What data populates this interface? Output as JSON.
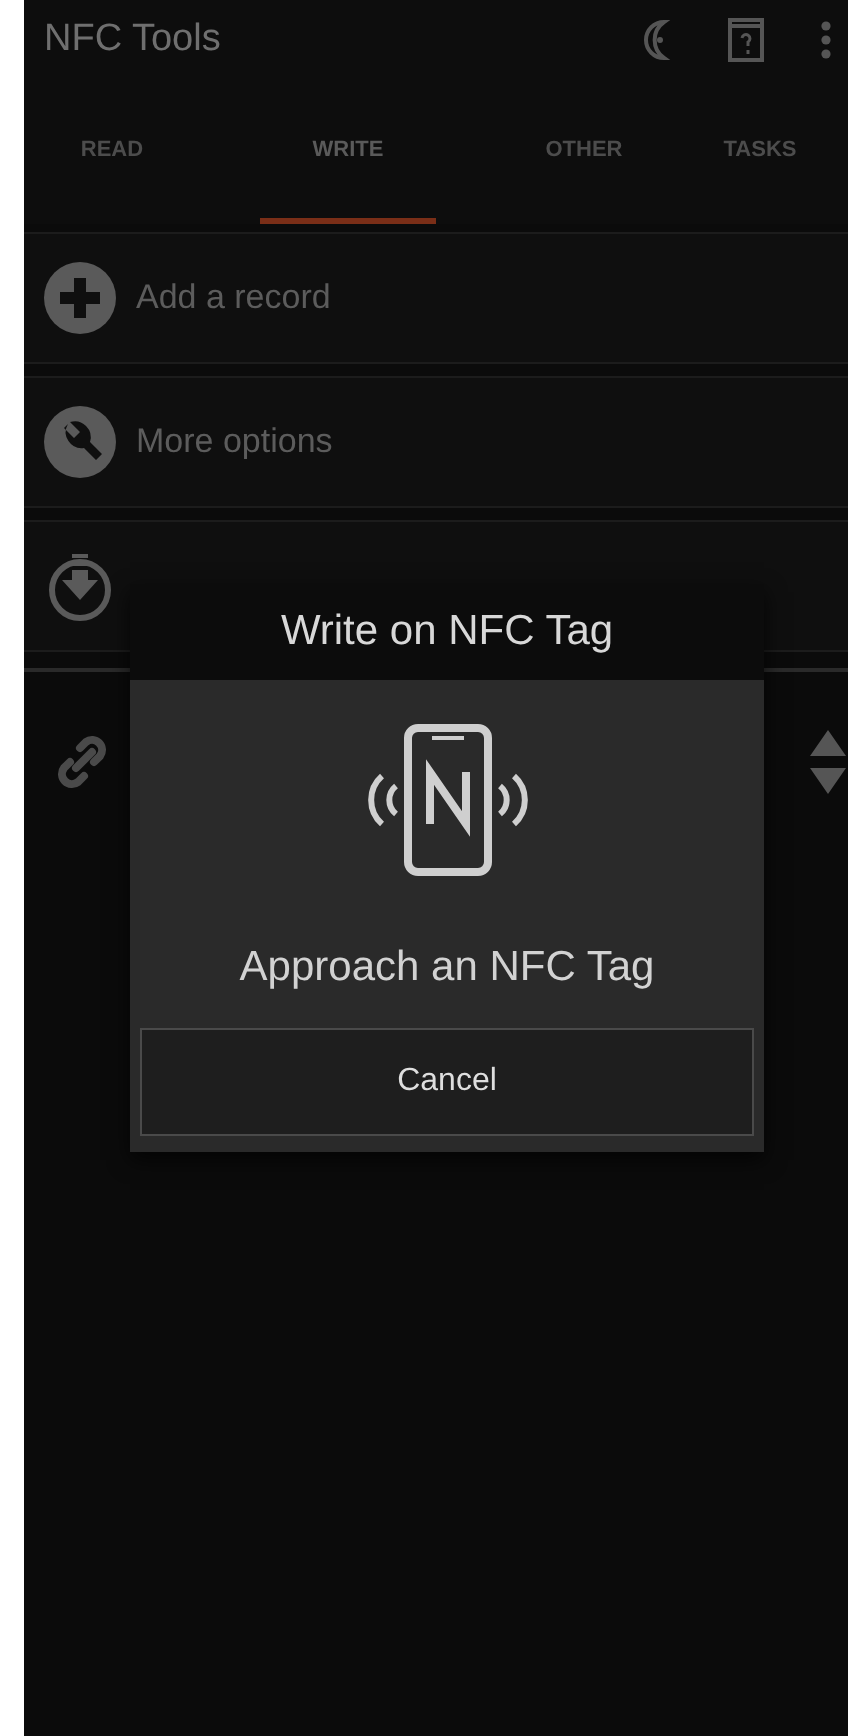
{
  "app_bar": {
    "title": "NFC Tools"
  },
  "tabs": [
    {
      "label": "READ",
      "selected": false
    },
    {
      "label": "WRITE",
      "selected": true
    },
    {
      "label": "OTHER",
      "selected": false
    },
    {
      "label": "TASKS",
      "selected": false
    }
  ],
  "actions": [
    {
      "kind": "add",
      "label": "Add a record"
    },
    {
      "kind": "options",
      "label": "More options"
    },
    {
      "kind": "write"
    }
  ],
  "dialog": {
    "title": "Write on NFC Tag",
    "message": "Approach an NFC Tag",
    "button": "Cancel"
  }
}
